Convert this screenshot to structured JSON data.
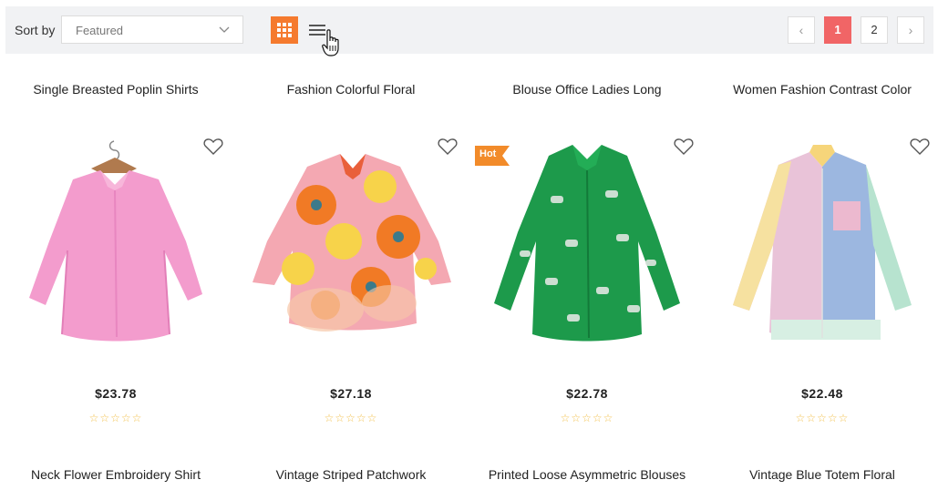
{
  "toolbar": {
    "sort_label": "Sort by",
    "sort_value": "Featured",
    "view_modes": [
      "grid-view-icon",
      "list-view-icon"
    ],
    "active_view": "grid",
    "accent_color": "#f57a2e"
  },
  "pagination": {
    "prev": "‹",
    "pages": [
      "1",
      "2"
    ],
    "current": "1",
    "next": "›",
    "active_color": "#f16566"
  },
  "products": [
    {
      "title": "Single Breasted Poplin Shirts",
      "price": "$23.78",
      "rating": "☆☆☆☆☆",
      "badge": "",
      "image": "pink-poplin-shirt"
    },
    {
      "title": "Fashion Colorful Floral",
      "price": "$27.18",
      "rating": "☆☆☆☆☆",
      "badge": "",
      "image": "floral-print-shirt"
    },
    {
      "title": "Blouse Office Ladies Long",
      "price": "$22.78",
      "rating": "☆☆☆☆☆",
      "badge": "Hot",
      "image": "green-zebra-blouse"
    },
    {
      "title": "Women Fashion Contrast Color",
      "price": "$22.48",
      "rating": "☆☆☆☆☆",
      "badge": "",
      "image": "pastel-colorblock-shirt"
    }
  ],
  "next_row_titles": [
    "Neck Flower Embroidery Shirt",
    "Vintage Striped Patchwork",
    "Printed Loose Asymmetric Blouses",
    "Vintage Blue Totem Floral"
  ]
}
